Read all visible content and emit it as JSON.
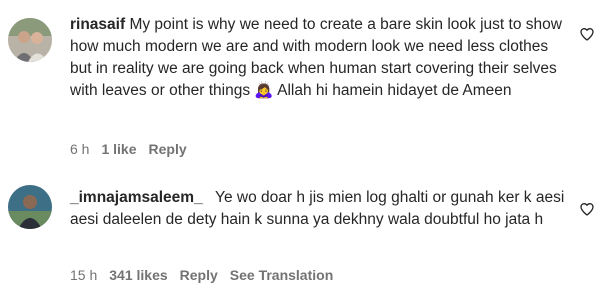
{
  "comments": [
    {
      "username": "rinasaif",
      "text": "My point is why we need to create a bare skin look just to show how much modern we are and with modern look we need less clothes but in reality we are going back when human start covering their selves with leaves or other things 🙇‍♀️ Allah hi hamein hidayet de Ameen",
      "time": "6 h",
      "likes": "1 like",
      "reply_label": "Reply",
      "like_icon": "heart-outline-icon"
    },
    {
      "username": "_imnajamsaleem_",
      "text": "Ye wo doar h jis mien log ghalti or gunah ker k aesi aesi daleelen de dety hain k sunna ya dekhny wala doubtful ho jata h",
      "time": "15 h",
      "likes": "341 likes",
      "reply_label": "Reply",
      "translation_label": "See Translation",
      "like_icon": "heart-outline-icon"
    }
  ],
  "colors": {
    "text": "#262626",
    "meta": "#737373",
    "background": "#ffffff"
  }
}
